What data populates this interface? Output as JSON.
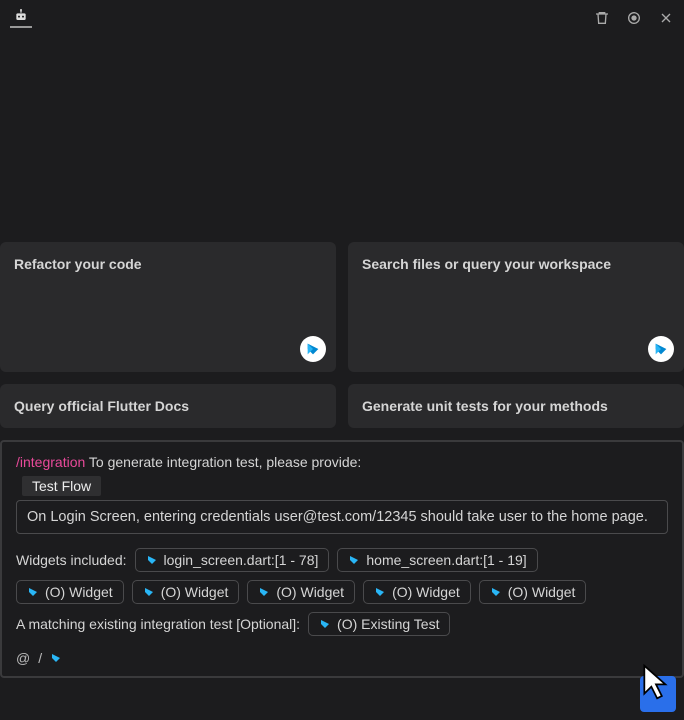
{
  "header": {
    "logo": "robot-icon"
  },
  "cards": {
    "refactor": "Refactor your code",
    "search": "Search files or query your workspace",
    "flutter_docs": "Query official Flutter Docs",
    "unit_tests": "Generate unit tests for your methods"
  },
  "panel": {
    "command": "/integration",
    "prompt": " To generate integration test, please provide:",
    "test_flow_label": "Test Flow",
    "description": "On Login Screen, entering credentials user@test.com/12345 should take user to the home page.",
    "widgets_label": "Widgets included:",
    "file_chips": [
      "login_screen.dart:[1 - 78]",
      "home_screen.dart:[1 - 19]"
    ],
    "widget_chips": [
      "(O) Widget",
      "(O) Widget",
      "(O) Widget",
      "(O) Widget",
      "(O) Widget"
    ],
    "match_label": "A matching existing integration test [Optional]:",
    "existing_chip": "(O) Existing Test",
    "footer_at": "@",
    "footer_slash": "/"
  },
  "colors": {
    "accent": "#2a6fea",
    "command": "#e84a9a",
    "dart_blue": "#0288D1"
  }
}
